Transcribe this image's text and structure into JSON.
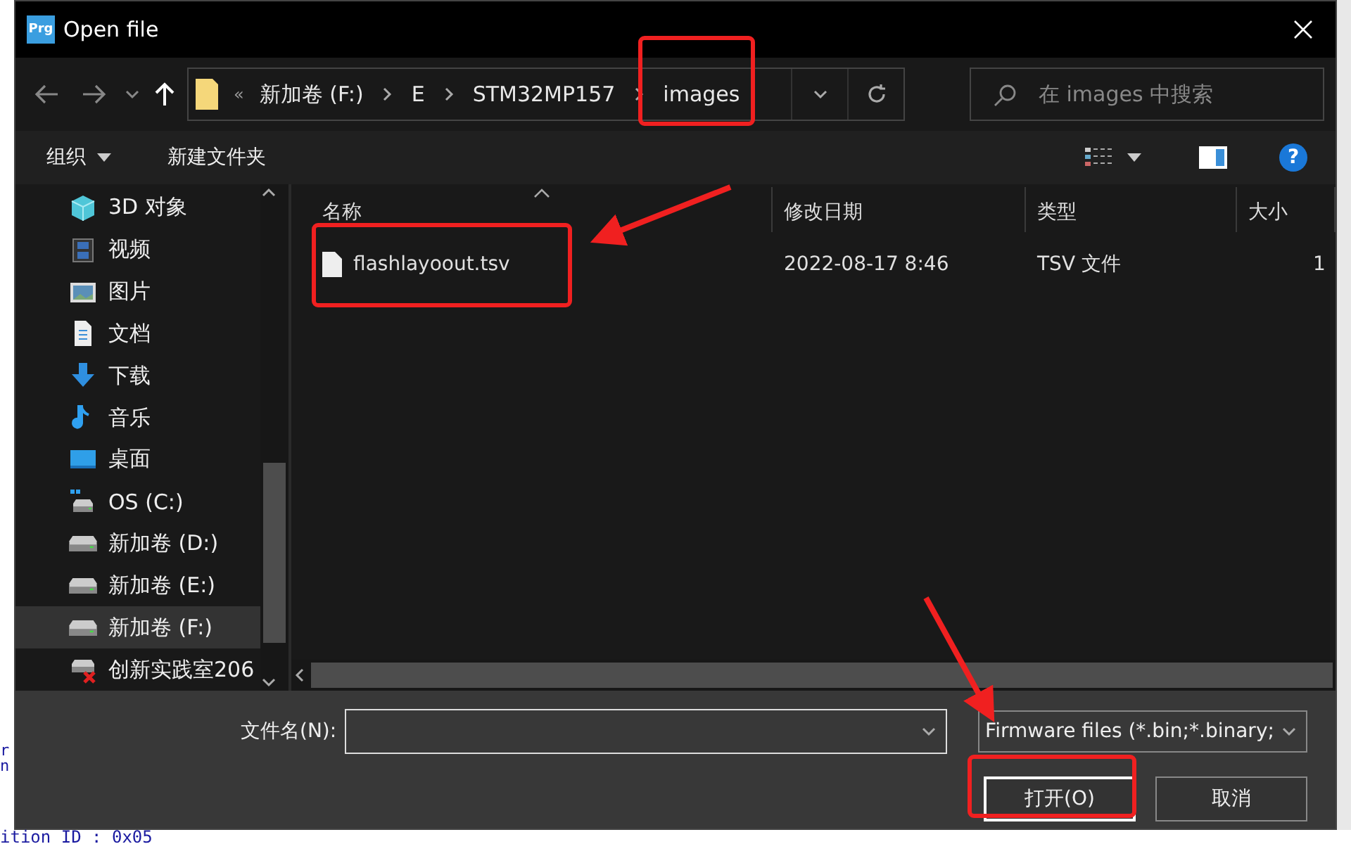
{
  "window": {
    "title": "Open file",
    "app_icon": "Prg"
  },
  "address_bar": {
    "overflow": "«",
    "crumbs": [
      "新加卷 (F:)",
      "E",
      "STM32MP157",
      "images"
    ]
  },
  "search": {
    "placeholder": "在 images 中搜索"
  },
  "toolbar": {
    "organize": "组织",
    "new_folder": "新建文件夹",
    "help": "?"
  },
  "nav": {
    "items": [
      {
        "label": "3D 对象",
        "kind": "cube",
        "selected": false
      },
      {
        "label": "视频",
        "kind": "video",
        "selected": false
      },
      {
        "label": "图片",
        "kind": "picture",
        "selected": false
      },
      {
        "label": "文档",
        "kind": "document",
        "selected": false
      },
      {
        "label": "下载",
        "kind": "download",
        "selected": false
      },
      {
        "label": "音乐",
        "kind": "music",
        "selected": false
      },
      {
        "label": "桌面",
        "kind": "desktop",
        "selected": false
      },
      {
        "label": "OS (C:)",
        "kind": "system-drive",
        "selected": false
      },
      {
        "label": "新加卷 (D:)",
        "kind": "drive",
        "selected": false
      },
      {
        "label": "新加卷 (E:)",
        "kind": "drive",
        "selected": false
      },
      {
        "label": "新加卷 (F:)",
        "kind": "drive",
        "selected": true
      },
      {
        "label": "创新实践室206",
        "kind": "network-drive",
        "selected": false
      }
    ]
  },
  "table": {
    "columns": [
      {
        "label": "名称",
        "sorted": true
      },
      {
        "label": "修改日期",
        "sorted": false
      },
      {
        "label": "类型",
        "sorted": false
      },
      {
        "label": "大小",
        "sorted": false
      }
    ],
    "rows": [
      {
        "name": "flashlayoout.tsv",
        "date": "2022-08-17 8:46",
        "type": "TSV 文件",
        "size": "1"
      }
    ]
  },
  "bottom": {
    "filename_label": "文件名(N):",
    "filter": "Firmware files (*.bin;*.binary;",
    "buttons": [
      {
        "label": "打开(O)",
        "default": true
      },
      {
        "label": "取消",
        "default": false
      }
    ]
  },
  "background_text": [
    "r",
    "n",
    "ition ID : 0x05"
  ]
}
